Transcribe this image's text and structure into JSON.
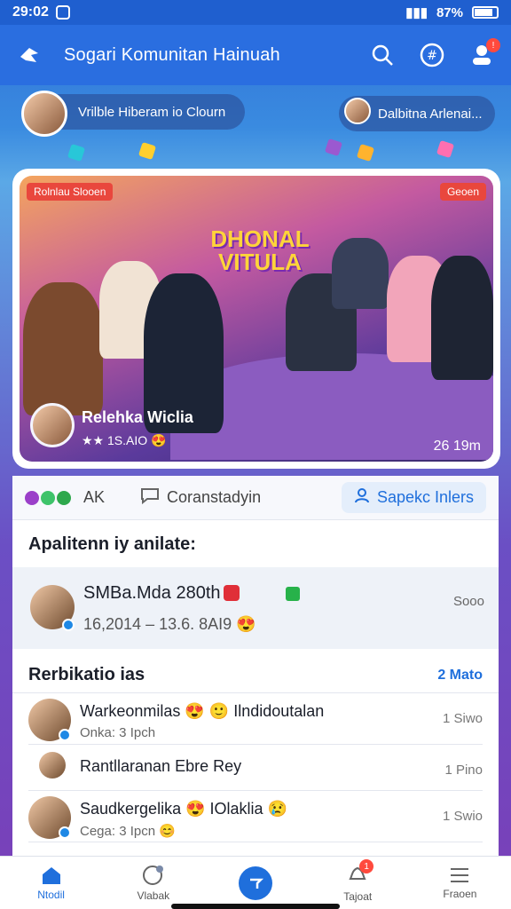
{
  "status": {
    "time": "29:02",
    "battery": "87%"
  },
  "app_bar": {
    "title": "Sogari Komunitan Hainuah"
  },
  "hero": {
    "left_pill": "Vrilble Hiberam io Clourn",
    "right_pill": "Dalbitna Arlenai..."
  },
  "feature": {
    "tag_left": "Rolnlau Slooen",
    "tag_right": "Geoen",
    "headline": "DHONAL VITULA",
    "caption": "Relehka Wiclia",
    "caption_sub": "★★ 1S.AIO 😍",
    "time": "26 19m"
  },
  "actions": {
    "reactions_label": "AK",
    "comment_label": "Coranstadyin",
    "primary_label": "Sapekc Inlers"
  },
  "activity": {
    "title": "Apalitenn iy anilate:",
    "featured_name": "SMBa.Mda 280th",
    "featured_meta": "16,2014 – 13.6. 8AI9 😍",
    "featured_side": "Sooo"
  },
  "notifications": {
    "title": "Rerbikatio ias",
    "more": "2 Mato",
    "items": [
      {
        "name": "Warkeonmilas 😍 🙂 Ilndidoutalan",
        "sub": "Onka: 3 Ipch",
        "time": "1 Siwo"
      },
      {
        "name": "Rantllaranan Ebre Rey",
        "sub": "",
        "time": "1 Pino"
      },
      {
        "name": "Saudkergelika 😍 IOlaklia 😢",
        "sub": "Cega: 3 Ipcn 😊",
        "time": "1 Swio"
      }
    ]
  },
  "nav": {
    "items": [
      {
        "label": "Ntodil"
      },
      {
        "label": "Vlabak"
      },
      {
        "label": ""
      },
      {
        "label": "Tajoat"
      },
      {
        "label": "Fraoen"
      }
    ]
  },
  "colors": {
    "primary": "#1f6fdc",
    "app_bar": "#2a6ee0",
    "badge": "#ff4a3d"
  }
}
